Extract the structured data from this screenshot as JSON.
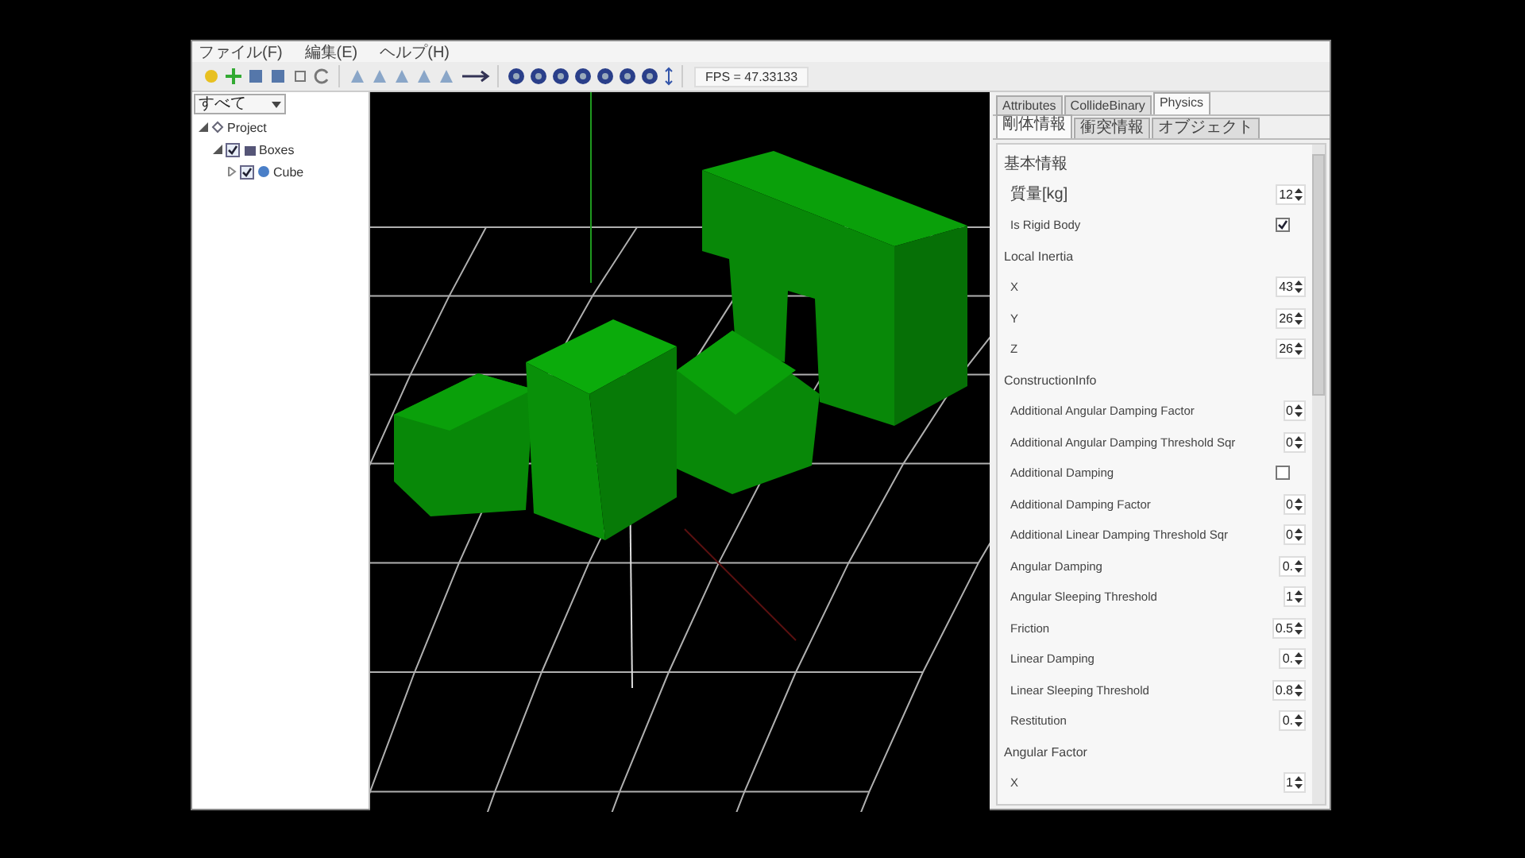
{
  "menu": [
    "ファイル(F)",
    "編集(E)",
    "ヘルプ(H)"
  ],
  "fps": "FPS = 47.33133",
  "filter": {
    "value": "すべて"
  },
  "tree": [
    {
      "label": "Project",
      "expanded": true,
      "kind": "root",
      "children": [
        {
          "label": "Boxes",
          "expanded": true,
          "checked": true,
          "kind": "folder",
          "children": [
            {
              "label": "Cube",
              "expanded": false,
              "checked": true,
              "kind": "object"
            }
          ]
        }
      ]
    }
  ],
  "tabs": [
    {
      "label": "Attributes",
      "selected": false
    },
    {
      "label": "CollideBinary",
      "selected": false
    },
    {
      "label": "Physics",
      "selected": true
    }
  ],
  "subtabs": [
    {
      "label": "剛体情報",
      "selected": true
    },
    {
      "label": "衝突情報",
      "selected": false
    },
    {
      "label": "オブジェクト",
      "selected": false
    }
  ],
  "sections": [
    {
      "title": "基本情報",
      "rows": [
        {
          "label": "質量[kg]",
          "kind": "spin",
          "value": "12"
        },
        {
          "label": "Is Rigid Body",
          "kind": "check",
          "checked": true
        }
      ]
    },
    {
      "title": "Local Inertia",
      "rows": [
        {
          "label": "X",
          "kind": "spin",
          "value": "43"
        },
        {
          "label": "Y",
          "kind": "spin",
          "value": "26"
        },
        {
          "label": "Z",
          "kind": "spin",
          "value": "26"
        }
      ]
    },
    {
      "title": "ConstructionInfo",
      "rows": [
        {
          "label": "Additional Angular Damping Factor",
          "kind": "spin",
          "value": "0"
        },
        {
          "label": "Additional Angular Damping Threshold Sqr",
          "kind": "spin",
          "value": "0"
        },
        {
          "label": "Additional Damping",
          "kind": "check",
          "checked": false
        },
        {
          "label": "Additional Damping Factor",
          "kind": "spin",
          "value": "0"
        },
        {
          "label": "Additional Linear Damping Threshold Sqr",
          "kind": "spin",
          "value": "0"
        },
        {
          "label": "Angular Damping",
          "kind": "spin",
          "value": "0."
        },
        {
          "label": "Angular Sleeping Threshold",
          "kind": "spin",
          "value": "1"
        },
        {
          "label": "Friction",
          "kind": "spin",
          "value": "0.5"
        },
        {
          "label": "Linear Damping",
          "kind": "spin",
          "value": "0."
        },
        {
          "label": "Linear Sleeping Threshold",
          "kind": "spin",
          "value": "0.8"
        },
        {
          "label": "Restitution",
          "kind": "spin",
          "value": "0."
        }
      ]
    },
    {
      "title": "Angular Factor",
      "rows": [
        {
          "label": "X",
          "kind": "spin",
          "value": "1"
        }
      ]
    }
  ]
}
